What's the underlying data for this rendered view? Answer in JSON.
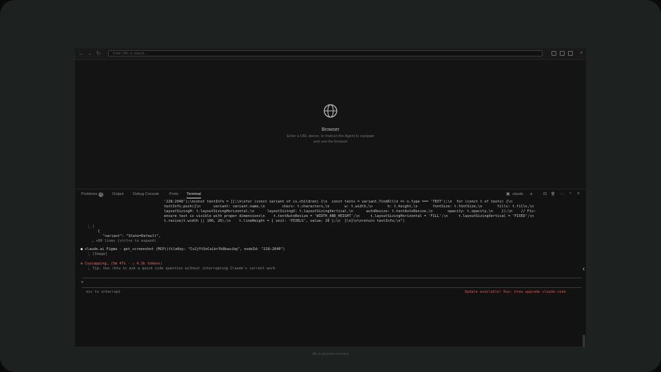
{
  "browser": {
    "back_icon": "←",
    "forward_icon": "→",
    "reload_icon": "↻",
    "url_placeholder": "Enter URL or search...",
    "close_icon": "×",
    "empty_title": "Browser",
    "empty_hint_line1": "Enter a URL above, or instruct the Agent to navigate",
    "empty_hint_line2": "and use the browser"
  },
  "panel": {
    "tabs": [
      {
        "label": "Problems",
        "badge": "3"
      },
      {
        "label": "Output"
      },
      {
        "label": "Debug Console"
      },
      {
        "label": "Ports"
      },
      {
        "label": "Terminal",
        "active": true
      }
    ],
    "terminal_name": "claude",
    "add_icon": "+",
    "split_icon": "⊟",
    "trash_icon": "🗑",
    "more_icon": "⋯",
    "maximize_icon": "^",
    "close_icon": "×"
  },
  "terminal": {
    "lines": [
      "'228:2040');\\nconst textInfo = [];\\n\\nfor (const variant of cs.children) {\\n  const texts = variant.findAll(n => n.type === 'TEXT');\\n  for (const t of texts) {\\n",
      "textInfo.push({\\n      variant: variant.name,\\n        chars: t.characters,\\n       w: t.width,\\n       h: t.height,\\n       fontSize: t.fontSize,\\n       fills: t.fills,\\n",
      "layoutSizingH: t.layoutSizingHorizontal,\\n      layoutSizingV: t.layoutSizingVertical,\\n      autoResize: t.textAutoResize,\\n       opacity: t.opacity,\\n    });\\n    // Fix:",
      "ensure text is visible with proper dimensions\\n    t.textAutoResize = 'WIDTH_AND_HEIGHT';\\n     t.layoutSizingHorizontal = 'FILL';\\n     t.layoutSizingVertical = 'FIXED';\\n",
      "t.resize(t.width || 100, 20);\\n    t.lineHeight = { unit: 'PIXELS', value: 20 };\\n  }\\n}\\n\\nreturn textInfo;\\n\")"
    ],
    "result_open": "⎿ [",
    "result_brace": "{",
    "result_variant": "\"variant\": \"State=Default\",",
    "result_more": "… +89 lines (ctrl+o to expand)",
    "tool_call": "claude.ai Figma - get_screenshot (MCP)(fileKey: \"Cv2jYtSnCuLbrYk8bauibg\", nodeId: \"228:2040\")",
    "tool_result": "⎿ [Image]",
    "status": "Coycapping… (5m 47s · ↓ 4.3k tokens)",
    "tip": "⎿ Tip: Use /btw to ask a quick side question without interrupting Claude's current work",
    "prompt": ">",
    "interrupt_hint": "esc to interrupt",
    "update_notice": "Update available! Run: brew upgrade claude-code",
    "bottom_hint": "⌘K to generate command"
  }
}
